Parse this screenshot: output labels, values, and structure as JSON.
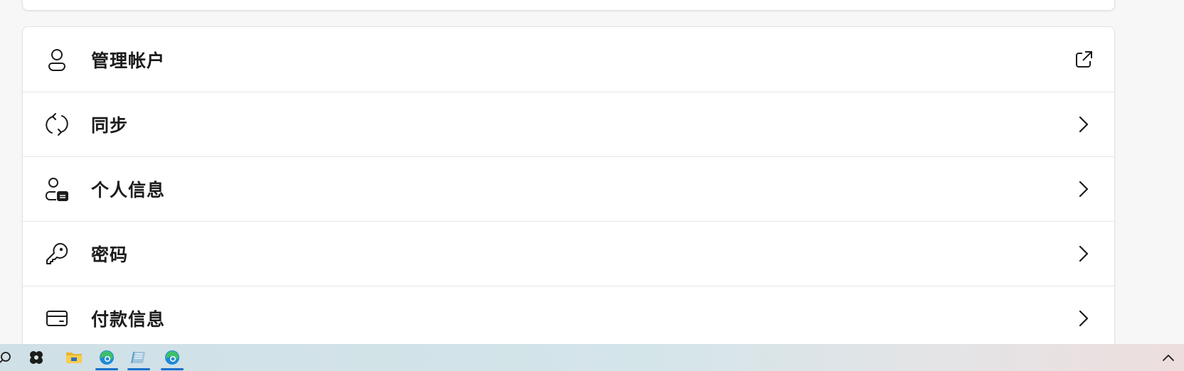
{
  "settings": {
    "items": [
      {
        "label": "管理帐户",
        "icon": "person-icon",
        "trailing": "external-link-icon"
      },
      {
        "label": "同步",
        "icon": "sync-icon",
        "trailing": "chevron-right-icon"
      },
      {
        "label": "个人信息",
        "icon": "person-card-icon",
        "trailing": "chevron-right-icon"
      },
      {
        "label": "密码",
        "icon": "key-icon",
        "trailing": "chevron-right-icon"
      },
      {
        "label": "付款信息",
        "icon": "credit-card-icon",
        "trailing": "chevron-right-icon"
      }
    ]
  },
  "taskbar": {
    "items": [
      {
        "name": "search-icon"
      },
      {
        "name": "app-icon"
      },
      {
        "name": "file-explorer-icon"
      },
      {
        "name": "edge-icon",
        "active": true
      },
      {
        "name": "notepad-icon",
        "active": true
      },
      {
        "name": "edge-icon",
        "active": true
      }
    ],
    "tray": {
      "icon": "chevron-up-icon"
    }
  },
  "colors": {
    "card_bg": "#ffffff",
    "page_bg": "#f7f7f7",
    "accent": "#1a6fc9",
    "text": "#1c1c1c"
  }
}
